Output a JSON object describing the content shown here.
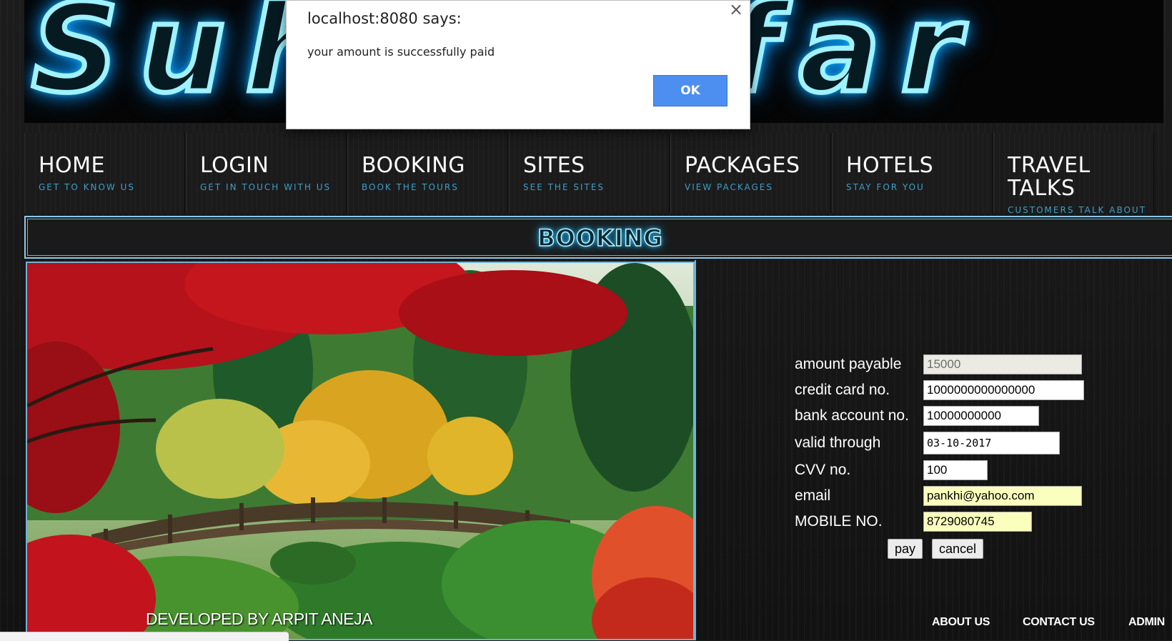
{
  "banner": {
    "word1": "Suh",
    "word2": "Safar"
  },
  "nav": [
    {
      "title": "HOME",
      "subtitle": "GET TO KNOW US"
    },
    {
      "title": "LOGIN",
      "subtitle": "GET IN TOUCH WITH US"
    },
    {
      "title": "BOOKING",
      "subtitle": "BOOK THE TOURS"
    },
    {
      "title": "SITES",
      "subtitle": "SEE THE SITES"
    },
    {
      "title": "PACKAGES",
      "subtitle": "VIEW PACKAGES"
    },
    {
      "title": "HOTELS",
      "subtitle": "STAY FOR YOU"
    },
    {
      "title": "TRAVEL TALKS",
      "subtitle": "CUSTOMERS TALK ABOUT TRAVEL"
    }
  ],
  "booking": {
    "title": "BOOKING"
  },
  "photo": {
    "caption": "DEVELOPED BY ARPIT ANEJA"
  },
  "form": {
    "amount_label": "amount payable",
    "amount_value": "15000",
    "card_label": "credit card no.",
    "card_value": "1000000000000000",
    "bank_label": "bank account no.",
    "bank_value": "10000000000",
    "valid_label": "valid through",
    "valid_value": "03-10-2017",
    "cvv_label": "CVV no.",
    "cvv_value": "100",
    "email_label": "email",
    "email_value": "pankhi@yahoo.com",
    "mobile_label": "MOBILE NO.",
    "mobile_value": "8729080745",
    "pay_label": "pay",
    "cancel_label": "cancel"
  },
  "footer": {
    "about": "ABOUT US",
    "contact": "CONTACT US",
    "admin": "ADMIN"
  },
  "alert": {
    "title": "localhost:8080 says:",
    "message": "your amount is successfully paid",
    "ok_label": "OK",
    "close_icon": "close-icon"
  },
  "colors": {
    "accent": "#4d8ff0",
    "neon": "#29c6ff",
    "nav_sub": "#3f9dc6",
    "frame": "#6fb3d6"
  }
}
